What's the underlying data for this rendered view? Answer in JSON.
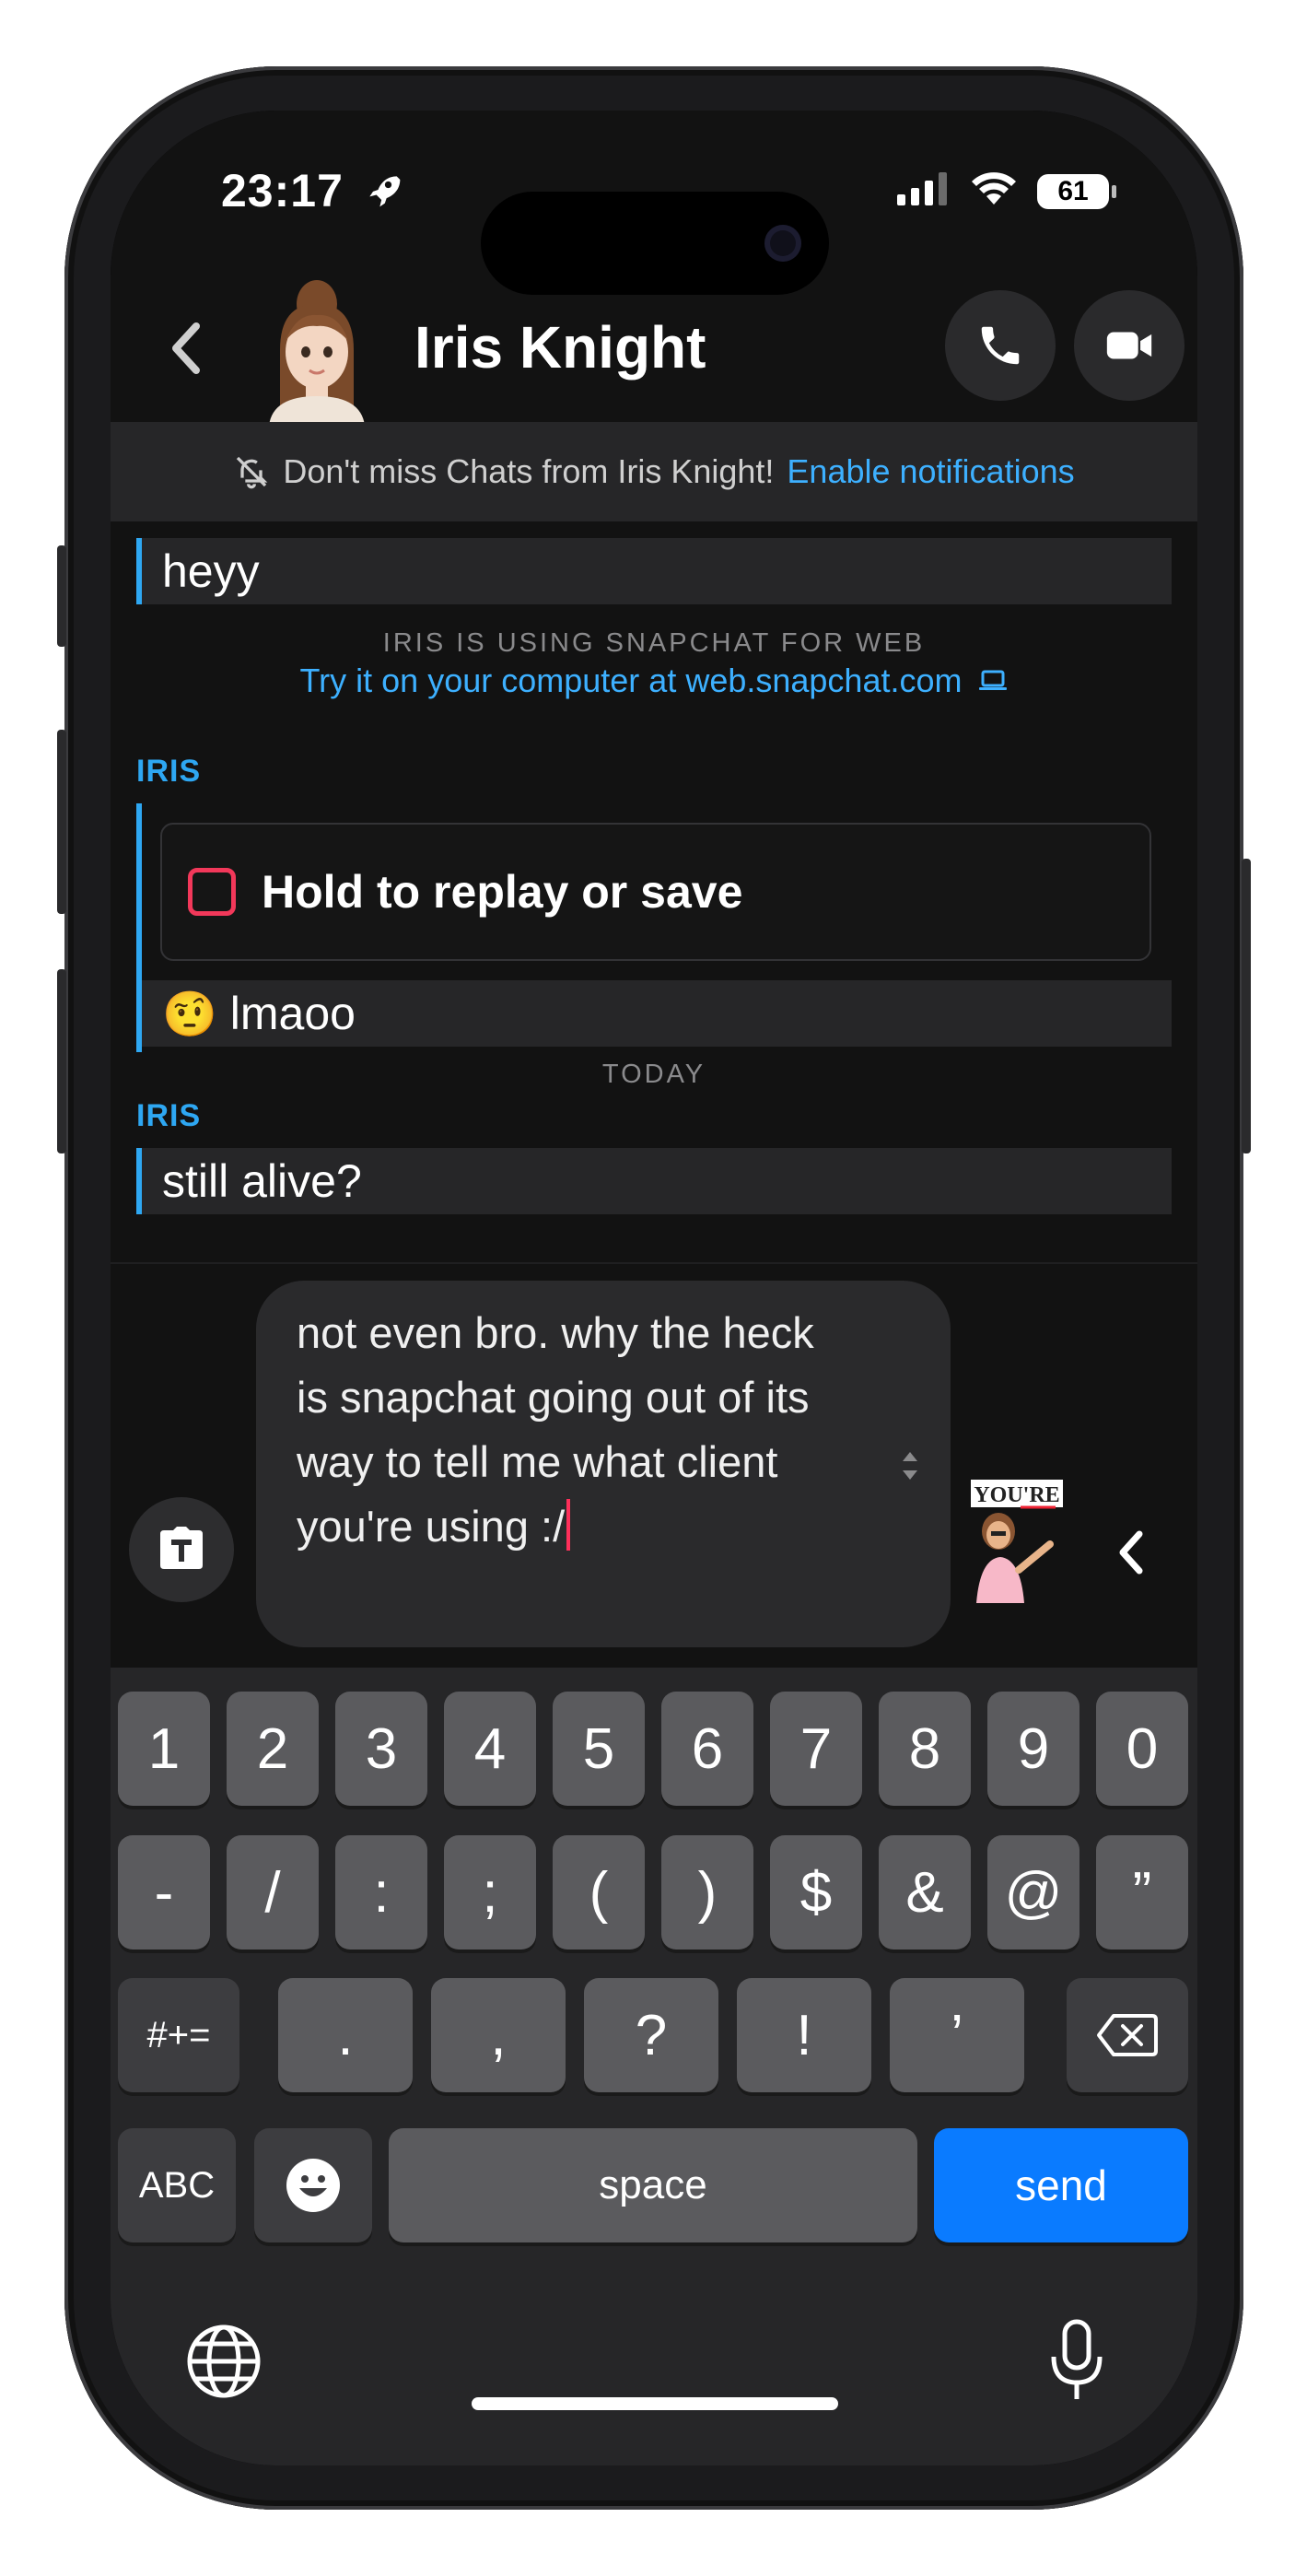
{
  "status": {
    "time": "23:17",
    "battery": "61"
  },
  "header": {
    "contact_name": "Iris Knight"
  },
  "notification": {
    "text": "Don't miss Chats from Iris Knight!",
    "link": "Enable notifications"
  },
  "chat": {
    "msg1": "heyy",
    "web_notice_title": "IRIS IS USING SNAPCHAT FOR WEB",
    "web_notice_link": "Try it on your computer at web.snapchat.com",
    "sender1": "IRIS",
    "snap_label": "Hold to replay or save",
    "msg2_emoji": "🤨",
    "msg2": "lmaoo",
    "day_separator": "TODAY",
    "sender2": "IRIS",
    "msg3": "still alive?"
  },
  "composer": {
    "text": "not even bro. why the heck is snapchat going out of its way to tell me what client you're using :/",
    "sticker_label": "YOU'RE"
  },
  "keyboard": {
    "row1": [
      "1",
      "2",
      "3",
      "4",
      "5",
      "6",
      "7",
      "8",
      "9",
      "0"
    ],
    "row2": [
      "-",
      "/",
      ":",
      ";",
      "(",
      ")",
      "$",
      "&",
      "@",
      "”"
    ],
    "row3": [
      ".",
      ",",
      "?",
      "!",
      "’"
    ],
    "shift_label": "#+=",
    "abc_label": "ABC",
    "space_label": "space",
    "send_label": "send"
  }
}
